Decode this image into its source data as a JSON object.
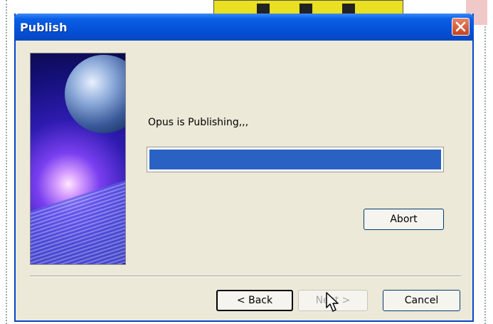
{
  "window": {
    "title": "Publish",
    "close_icon": "close-icon"
  },
  "status": {
    "message": "Opus is Publishing,,,",
    "progress": 1.0
  },
  "buttons": {
    "abort": "Abort",
    "back": "< Back",
    "next": "Next >",
    "cancel": "Cancel"
  },
  "colors": {
    "titlebar": "#0551d8",
    "progress_fill": "#2a62c4",
    "dialog_bg": "#ece9d8"
  }
}
